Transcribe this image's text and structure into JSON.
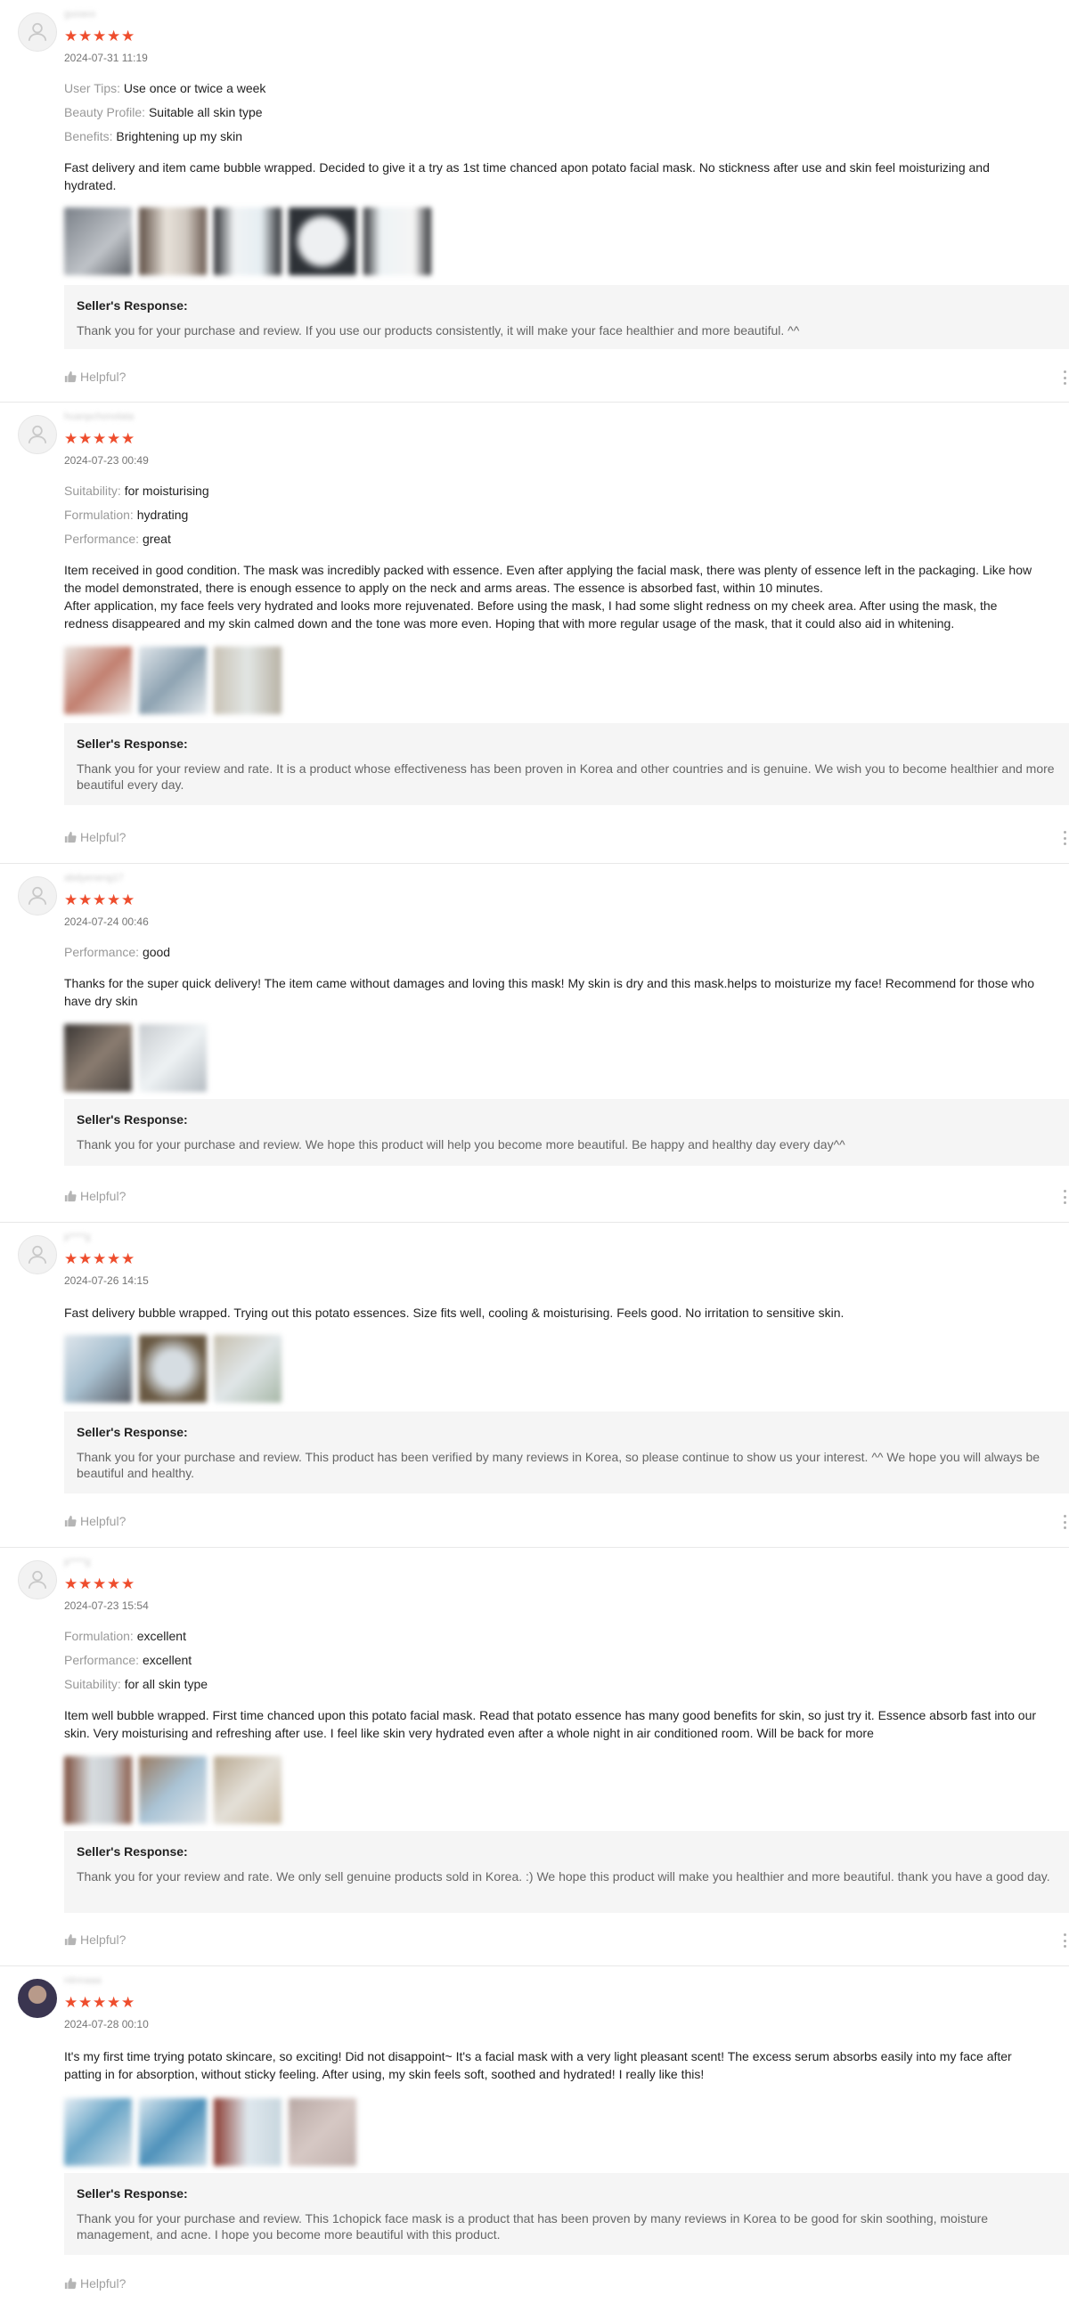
{
  "reviews": [
    {
      "username": "guoaxx",
      "datetime": "2024-07-31 11:19",
      "attributes": [
        {
          "key": "User Tips:",
          "value": "Use once or twice a week"
        },
        {
          "key": "Beauty Profile:",
          "value": "Suitable all skin type"
        },
        {
          "key": "Benefits:",
          "value": "Brightening up my skin"
        }
      ],
      "text": "Fast delivery and item came bubble wrapped. Decided to give it a try as 1st time chanced apon potato facial mask. No stickness after use and skin feel moisturizing and hydrated.",
      "response_title": "Seller's Response:",
      "response_body": "Thank you for your purchase and review. If you use our products consistently, it will make your face healthier and more beautiful. ^^",
      "helpful": "Helpful?"
    },
    {
      "username": "huanpchonolata",
      "datetime": "2024-07-23 00:49",
      "attributes": [
        {
          "key": "Suitability:",
          "value": "for moisturising"
        },
        {
          "key": "Formulation:",
          "value": "hydrating"
        },
        {
          "key": "Performance:",
          "value": "great"
        }
      ],
      "text": "Item received in good condition. The mask was incredibly packed with essence. Even after applying the facial mask, there was plenty of essence left in the packaging. Like how the model demonstrated, there is enough essence to apply on the neck and arms areas. The essence is absorbed fast, within 10 minutes.\nAfter application, my face feels very hydrated and looks more rejuvenated. Before using the mask, I had some slight redness on my cheek area. After using the mask, the redness disappeared and my skin calmed down and the tone was more even. Hoping that with more regular usage of the mask, that it could also aid in whitening.",
      "response_title": "Seller's Response:",
      "response_body": "Thank you for your review and rate. It is a product whose effectiveness has been proven in Korea and other countries and is genuine. We wish you to become healthier and more beautiful every day.",
      "helpful": "Helpful?"
    },
    {
      "username": "abdyeneng17",
      "datetime": "2024-07-24 00:46",
      "attributes": [
        {
          "key": "Performance:",
          "value": "good"
        }
      ],
      "text": "Thanks for the super quick delivery! The item came without damages and loving this mask! My skin is dry and this mask.helps to moisturize my face! Recommend for those who have dry skin",
      "response_title": "Seller's Response:",
      "response_body": "Thank you for your purchase and review. We hope this product will help you become more beautiful. Be happy and healthy day every day^^",
      "helpful": "Helpful?"
    },
    {
      "username": "p****g",
      "datetime": "2024-07-26 14:15",
      "attributes": [],
      "text": "Fast delivery bubble wrapped. Trying out this potato essences. Size fits well, cooling & moisturising. Feels good. No irritation to sensitive skin.",
      "response_title": "Seller's Response:",
      "response_body": "Thank you for your purchase and review. This product has been verified by many reviews in Korea, so please continue to show us your interest. ^^ We hope you will always be beautiful and healthy.",
      "helpful": "Helpful?"
    },
    {
      "username": "p****g",
      "datetime": "2024-07-23 15:54",
      "attributes": [
        {
          "key": "Formulation:",
          "value": "excellent"
        },
        {
          "key": "Performance:",
          "value": "excellent"
        },
        {
          "key": "Suitability:",
          "value": "for all skin type"
        }
      ],
      "text": "Item well bubble wrapped. First time chanced upon this potato facial mask. Read that potato essence has many good benefits for skin, so just try it. Essence absorb fast into our skin. Very moisturising and refreshing after use. I feel like skin very hydrated even after a whole night in air conditioned room. Will be back for more",
      "response_title": "Seller's Response:",
      "response_body": "Thank you for your review and rate. We only sell genuine products sold in Korea. :) We hope this product will make you healthier and more beautiful. thank you have a good day.",
      "helpful": "Helpful?"
    },
    {
      "username": "niinnaaa",
      "datetime": "2024-07-28 00:10",
      "attributes": [],
      "text": "It's my first time trying potato skincare, so exciting! Did not disappoint~ It's a facial mask with a very light pleasant scent! The excess serum absorbs easily into my face after patting in for absorption, without sticky feeling. After using, my skin feels soft, soothed and hydrated! I really like this!",
      "response_title": "Seller's Response:",
      "response_body": "Thank you for your purchase and review. This 1chopick face mask is a product that has been proven by many reviews in Korea to be good for skin soothing, moisture management, and acne. I hope you become more beautiful with this product.",
      "helpful": "Helpful?"
    }
  ],
  "icons": {
    "star": "star-icon",
    "avatar": "user-icon",
    "thumb": "thumbs-up-icon",
    "more": "more-vertical-icon"
  },
  "colors": {
    "star": "#ee4d2d",
    "response_bg": "#f5f5f5",
    "muted": "#999999"
  }
}
